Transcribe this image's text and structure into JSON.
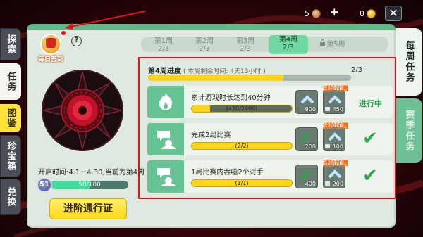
{
  "topbar": {
    "copper_amount": "5",
    "plus": "+",
    "gold_amount": "0",
    "close_symbol": "✕"
  },
  "left_tabs": [
    {
      "label": "探索"
    },
    {
      "label": "任务"
    },
    {
      "label": "图鉴"
    },
    {
      "label": "珍宝箱"
    },
    {
      "label": "兑换"
    }
  ],
  "right_tabs": [
    {
      "label": "每周任务"
    },
    {
      "label": "赛季任务"
    }
  ],
  "sidebar": {
    "gift_label": "每日签到",
    "help_symbol": "?",
    "open_time": "开启时间:4.1－4.30,当前为第4周",
    "level": "51",
    "level_progress_text": "50/100",
    "level_progress": 0.5,
    "pass_button": "进阶通行证"
  },
  "weeks": [
    {
      "label": "第1周",
      "count": "2/3"
    },
    {
      "label": "第2周",
      "count": "2/3"
    },
    {
      "label": "第3周",
      "count": "2/3"
    },
    {
      "label": "第4周",
      "count": "2/3"
    },
    {
      "label": "第5周",
      "count": ""
    }
  ],
  "progress": {
    "title": "第4周进度",
    "subtitle": "( 本周剩余时间: 4天13小时 )",
    "count": "2/3",
    "fraction": 0.667
  },
  "adv_tag": "进阶加赠",
  "tasks": [
    {
      "text": "累计游戏时长达到40分钟",
      "bar_text": "(430/2400)",
      "fraction": 0.18,
      "reward1": "900",
      "reward2": "450",
      "status": "进行中"
    },
    {
      "text": "完成2局比赛",
      "bar_text": "(2/2)",
      "fraction": 1,
      "reward1": "200",
      "reward2": "100",
      "status": ""
    },
    {
      "text": "1局比赛内吞噬2个对手",
      "bar_text": "(1/1)",
      "fraction": 1,
      "reward1": "400",
      "reward2": "200",
      "status": ""
    }
  ],
  "colors": {
    "accent_green": "#67c294",
    "highlight_red": "#e0121b",
    "bar_yellow": "#ffd21a"
  }
}
